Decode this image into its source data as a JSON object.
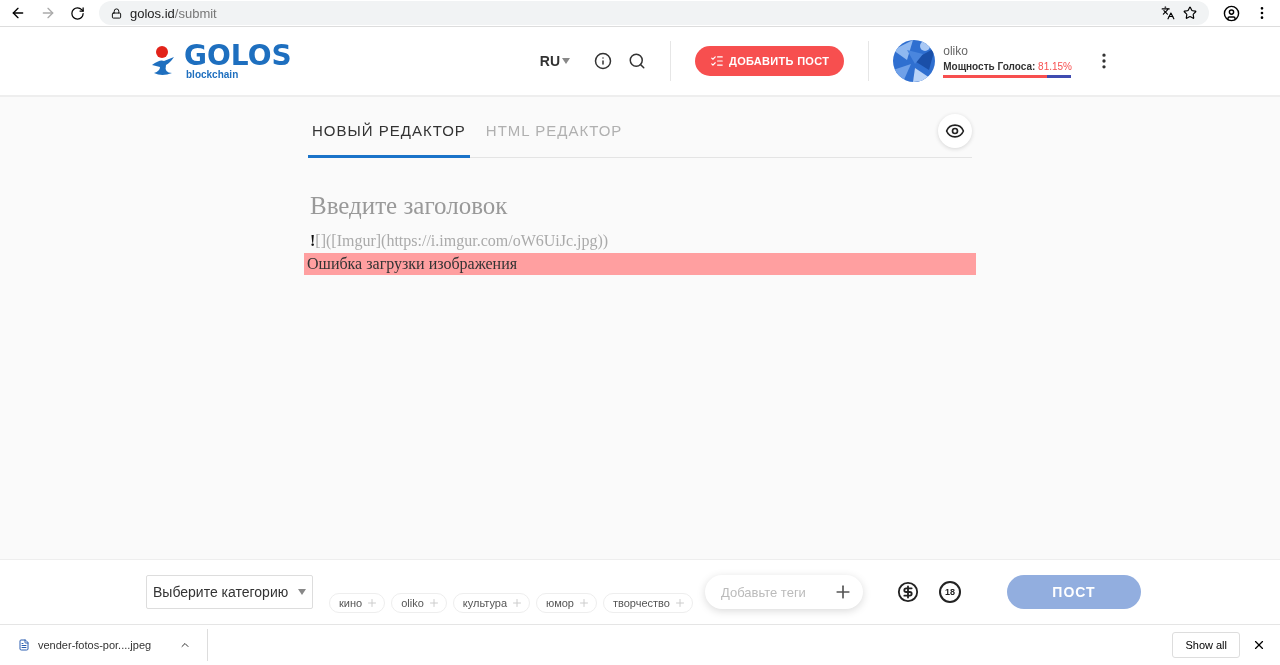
{
  "browser": {
    "url_host": "golos.id",
    "url_path": "/submit"
  },
  "header": {
    "logo": "GOLOS",
    "logo_sub": "blockchain",
    "language": "RU",
    "add_post": "ДОБАВИТЬ ПОСТ",
    "user": {
      "name": "oliko",
      "power_label": "Мощность Голоса:",
      "power_value": "81.15%",
      "level": 0.8115
    }
  },
  "tabs": [
    {
      "label": "НОВЫЙ РЕДАКТОР",
      "selected": true
    },
    {
      "label": "HTML РЕДАКТОР",
      "selected": false
    }
  ],
  "editor": {
    "title_placeholder": "Введите заголовок",
    "body": "**!**[]([Imgur](https://i.imgur.com/oW6UiJc.jpg))",
    "error": "Ошибка загрузки изображения"
  },
  "footer": {
    "category": "Выберите категорию",
    "tags": [
      "кино",
      "oliko",
      "культура",
      "юмор",
      "творчество"
    ],
    "tag_placeholder": "Добавьте теги",
    "adult_label": "18",
    "post": "ПОСТ"
  },
  "downloads": {
    "file": "vender-fotos-por....jpeg",
    "show_all": "Show all"
  }
}
